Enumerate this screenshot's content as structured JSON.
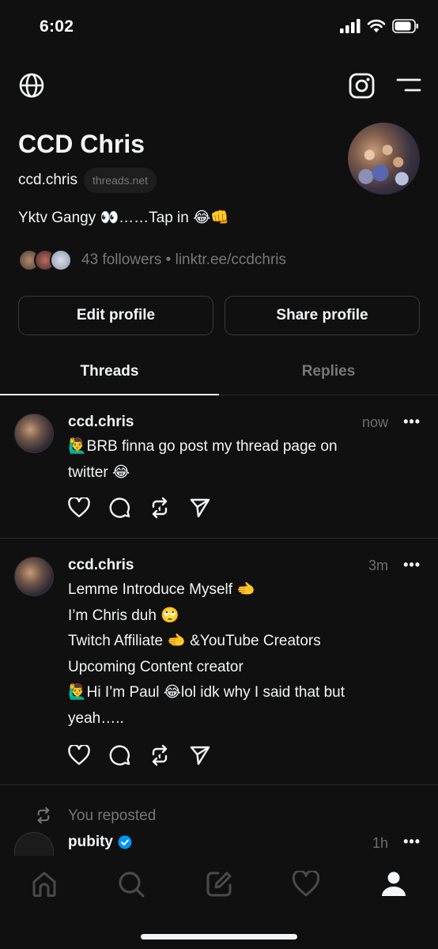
{
  "status_bar": {
    "time": "6:02"
  },
  "profile": {
    "name": "CCD Chris",
    "handle": "ccd.chris",
    "domain": "threads.net",
    "bio": "Yktv Gangy 👀……Tap in 😂👊",
    "followers_text": "43 followers • linktr.ee/ccdchris"
  },
  "buttons": {
    "edit": "Edit profile",
    "share": "Share profile"
  },
  "tabs": {
    "threads": "Threads",
    "replies": "Replies"
  },
  "posts": [
    {
      "user": "ccd.chris",
      "time": "now",
      "lines": [
        "🙋‍♂️BRB finna go post my thread page on",
        "twitter 😂"
      ]
    },
    {
      "user": "ccd.chris",
      "time": "3m",
      "lines": [
        "Lemme Introduce Myself 🫲",
        "I’m Chris duh 🙄",
        "Twitch Affiliate 🫲 &YouTube Creators",
        "Upcoming Content creator",
        "🙋‍♂️Hi I’m Paul 😂lol idk why I said that but",
        "yeah….."
      ]
    }
  ],
  "repost": {
    "label": "You reposted"
  },
  "pubity_post": {
    "user": "pubity",
    "time": "1h"
  },
  "more_label": "•••",
  "icons": {
    "globe": "globe-icon",
    "instagram": "instagram-icon",
    "menu": "menu-icon",
    "like": "heart-icon",
    "comment": "comment-icon",
    "repost": "repost-icon",
    "share": "send-icon",
    "verified": "verified-badge-icon",
    "nav": [
      "home-icon",
      "search-icon",
      "compose-icon",
      "activity-icon",
      "profile-icon"
    ]
  }
}
